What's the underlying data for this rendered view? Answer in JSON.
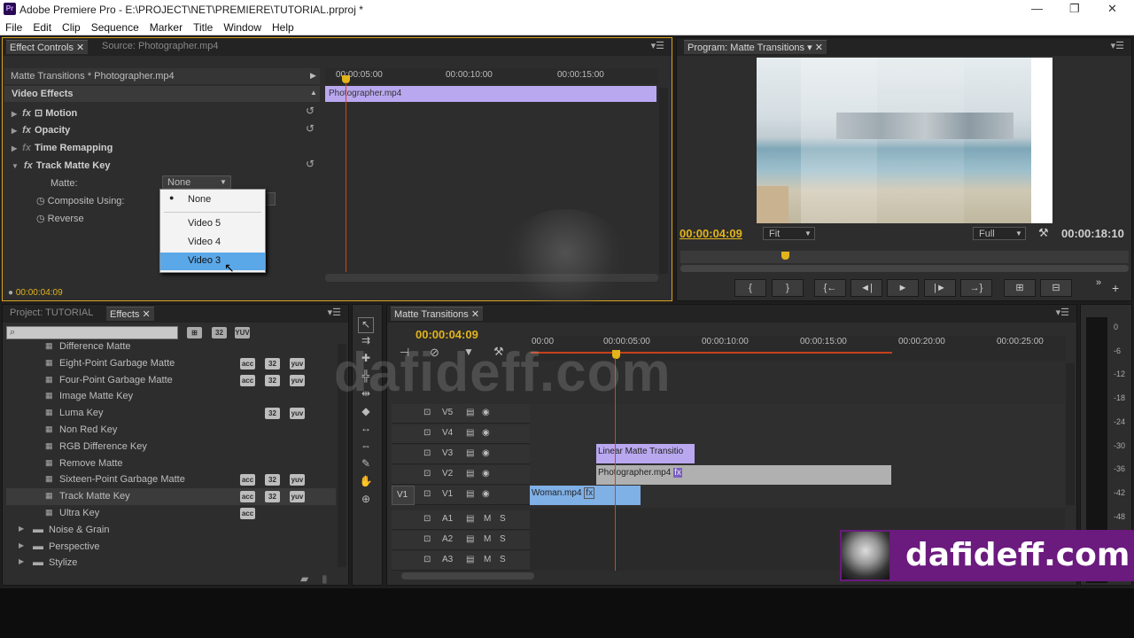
{
  "window": {
    "title": "Adobe Premiere Pro - E:\\PROJECT\\NET\\PREMIERE\\TUTORIAL.prproj *",
    "app_icon": "Pr",
    "minimize": "—",
    "restore": "❐",
    "close": "✕"
  },
  "menu": [
    "File",
    "Edit",
    "Clip",
    "Sequence",
    "Marker",
    "Title",
    "Window",
    "Help"
  ],
  "effect_controls": {
    "tab_active": "Effect Controls",
    "tab_inactive": "Source: Photographer.mp4",
    "clip_label": "Matte Transitions * Photographer.mp4",
    "ruler": [
      "00:00:05:00",
      "00:00:10:00",
      "00:00:15:00"
    ],
    "clip_bar": "Photographer.mp4",
    "section": "Video Effects",
    "effects": [
      "Motion",
      "Opacity",
      "Time Remapping",
      "Track Matte Key"
    ],
    "params": {
      "matte_label": "Matte:",
      "matte_value": "None",
      "composite_label": "Composite Using:",
      "reverse_label": "Reverse"
    },
    "dropdown": [
      "None",
      "Video 5",
      "Video 4",
      "Video 3"
    ],
    "dropdown_selected": "Video 3",
    "timecode": "00:00:04:09"
  },
  "program": {
    "tab": "Program: Matte Transitions",
    "timecode_current": "00:00:04:09",
    "fit": "Fit",
    "quality": "Full",
    "timecode_duration": "00:00:18:10",
    "transport": [
      "{",
      "}",
      "{←",
      "◄|",
      "►",
      "|►",
      "→}",
      "⊞",
      "⊟"
    ]
  },
  "project": {
    "tab_inactive": "Project: TUTORIAL",
    "tab_active": "Effects",
    "items": [
      {
        "name": "Difference Matte",
        "badges": []
      },
      {
        "name": "Eight-Point Garbage Matte",
        "badges": [
          "acc",
          "32",
          "yuv"
        ]
      },
      {
        "name": "Four-Point Garbage Matte",
        "badges": [
          "acc",
          "32",
          "yuv"
        ]
      },
      {
        "name": "Image Matte Key",
        "badges": []
      },
      {
        "name": "Luma Key",
        "badges": [
          "32",
          "yuv"
        ]
      },
      {
        "name": "Non Red Key",
        "badges": []
      },
      {
        "name": "RGB Difference Key",
        "badges": []
      },
      {
        "name": "Remove Matte",
        "badges": []
      },
      {
        "name": "Sixteen-Point Garbage Matte",
        "badges": [
          "acc",
          "32",
          "yuv"
        ]
      },
      {
        "name": "Track Matte Key",
        "badges": [
          "acc",
          "32",
          "yuv"
        ]
      },
      {
        "name": "Ultra Key",
        "badges": [
          "acc"
        ]
      }
    ],
    "folders": [
      "Noise & Grain",
      "Perspective",
      "Stylize"
    ],
    "badge_labels": {
      "acc": "⊞",
      "32": "32",
      "yuv": "YUV"
    }
  },
  "timeline": {
    "tab": "Matte Transitions",
    "timecode": "00:00:04:09",
    "ruler": [
      "00:00",
      "00:00:05:00",
      "00:00:10:00",
      "00:00:15:00",
      "00:00:20:00",
      "00:00:25:00"
    ],
    "video_tracks": [
      "V5",
      "V4",
      "V3",
      "V2",
      "V1"
    ],
    "audio_tracks": [
      "A1",
      "A2",
      "A3"
    ],
    "source_patch": "V1",
    "m": "M",
    "s": "S",
    "clips": {
      "linear": "Linear Matte Transitio",
      "photographer": "Photographer.mp4",
      "woman": "Woman.mp4",
      "fx": "fx"
    }
  },
  "meter": {
    "labels": [
      "0",
      "-6",
      "-12",
      "-18",
      "-24",
      "-30",
      "-36",
      "-42",
      "-48"
    ]
  },
  "watermark": {
    "big": "dafideff.com",
    "banner": "dafideff.com"
  },
  "colors": {
    "accent": "#e2b41b",
    "selection": "#5ba8e8",
    "clip_lilac": "#b9a8f0",
    "clip_blue": "#7fb0e6",
    "clip_gray": "#b0b0b0",
    "banner": "#6b1a7e"
  }
}
